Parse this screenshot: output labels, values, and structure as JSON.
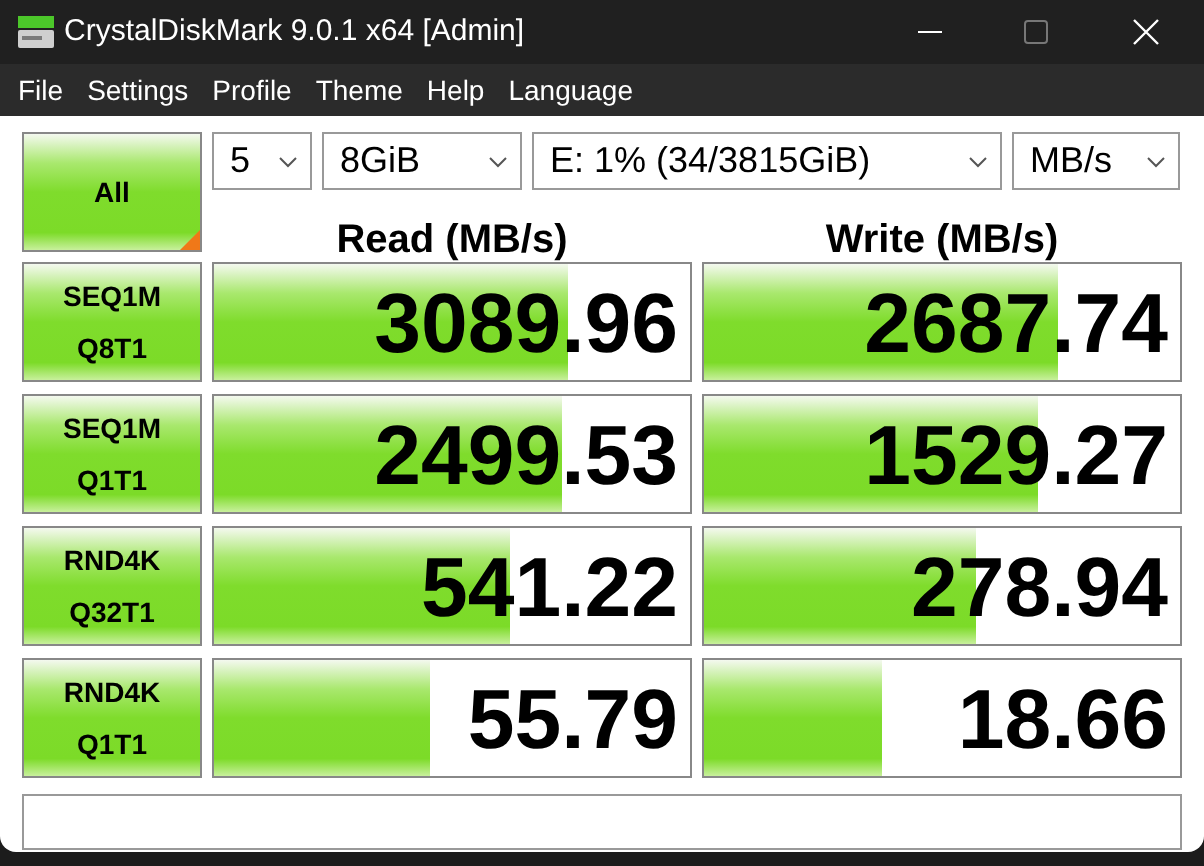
{
  "window": {
    "title": "CrystalDiskMark 9.0.1 x64 [Admin]"
  },
  "menu": [
    "File",
    "Settings",
    "Profile",
    "Theme",
    "Help",
    "Language"
  ],
  "all_button": {
    "label": "All"
  },
  "selectors": [
    {
      "value": "5"
    },
    {
      "value": "8GiB"
    },
    {
      "value": "E: 1% (34/3815GiB)"
    },
    {
      "value": "MB/s"
    }
  ],
  "columns": [
    "Read (MB/s)",
    "Write (MB/s)"
  ],
  "tests": [
    {
      "label": "SEQ1M\nQ8T1",
      "read": {
        "value": "3089.96",
        "level": 0.745
      },
      "write": {
        "value": "2687.74",
        "level": 0.745
      }
    },
    {
      "label": "SEQ1M\nQ1T1",
      "read": {
        "value": "2499.53",
        "level": 0.73
      },
      "write": {
        "value": "1529.27",
        "level": 0.7
      }
    },
    {
      "label": "RND4K\nQ32T1",
      "read": {
        "value": "541.22",
        "level": 0.62
      },
      "write": {
        "value": "278.94",
        "level": 0.57
      }
    },
    {
      "label": "RND4K\nQ1T1",
      "read": {
        "value": "55.79",
        "level": 0.455
      },
      "write": {
        "value": "18.66",
        "level": 0.375
      }
    }
  ]
}
